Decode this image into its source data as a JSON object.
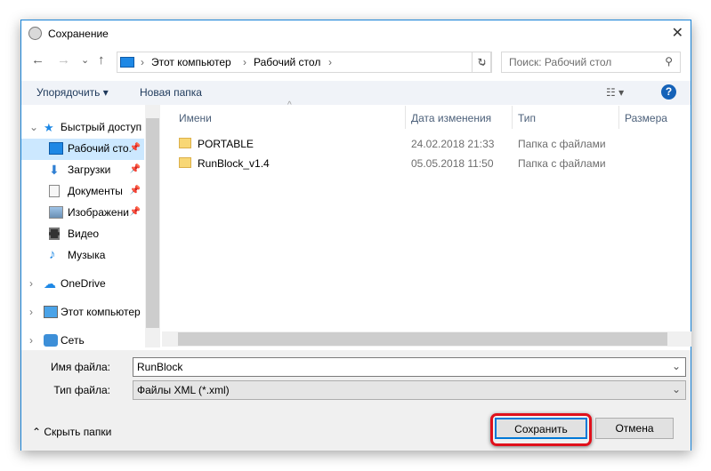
{
  "window": {
    "title": "Сохранение",
    "close": "✕"
  },
  "nav": {
    "back": "←",
    "forward": "→",
    "recent": "⌄",
    "up": "↑",
    "crumbs": [
      "Этот компьютер",
      "Рабочий стол"
    ],
    "refresh": "↻",
    "search_placeholder": "Поиск: Рабочий стол"
  },
  "toolbar": {
    "organize": "Упорядочить ▾",
    "new_folder": "Новая папка",
    "view": "☷ ▾",
    "help": "?"
  },
  "sidebar": {
    "quick": "Быстрый доступ",
    "items": [
      "Рабочий сто.",
      "Загрузки",
      "Документы",
      "Изображени",
      "Видео",
      "Музыка"
    ],
    "onedrive": "OneDrive",
    "pc": "Этот компьютер",
    "net": "Сеть"
  },
  "columns": [
    "Имени",
    "Дата изменения",
    "Тип",
    "Размера"
  ],
  "files": [
    {
      "name": "PORTABLE",
      "date": "24.02.2018 21:33",
      "type": "Папка с файлами"
    },
    {
      "name": "RunBlock_v1.4",
      "date": "05.05.2018 11:50",
      "type": "Папка с файлами"
    }
  ],
  "form": {
    "filename_label": "Имя файла:",
    "filename": "RunBlock",
    "filetype_label": "Тип файла:",
    "filetype": "Файлы XML (*.xml)"
  },
  "footer": {
    "hide": "Скрыть папки",
    "save": "Сохранить",
    "cancel": "Отмена"
  }
}
